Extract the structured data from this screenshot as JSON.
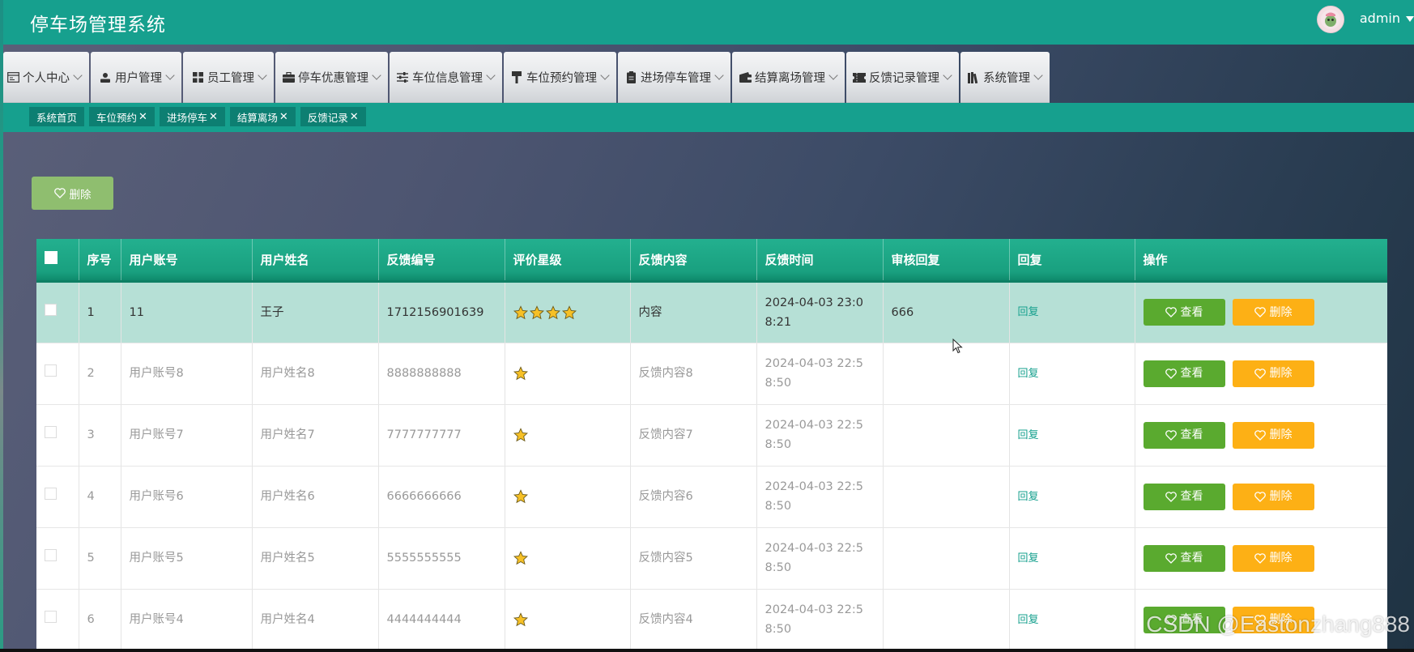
{
  "app": {
    "title": "停车场管理系统"
  },
  "user": {
    "name": "admin"
  },
  "menu": [
    {
      "label": "个人中心",
      "icon": "profile-card-icon"
    },
    {
      "label": "用户管理",
      "icon": "user-icon"
    },
    {
      "label": "员工管理",
      "icon": "grid-icon"
    },
    {
      "label": "停车优惠管理",
      "icon": "briefcase-icon"
    },
    {
      "label": "车位信息管理",
      "icon": "sliders-icon"
    },
    {
      "label": "车位预约管理",
      "icon": "pin-icon"
    },
    {
      "label": "进场停车管理",
      "icon": "clipboard-icon"
    },
    {
      "label": "结算离场管理",
      "icon": "wallet-icon"
    },
    {
      "label": "反馈记录管理",
      "icon": "ticket-icon"
    },
    {
      "label": "系统管理",
      "icon": "books-icon"
    }
  ],
  "tags": [
    {
      "label": "系统首页",
      "closable": false
    },
    {
      "label": "车位预约",
      "closable": true
    },
    {
      "label": "进场停车",
      "closable": true
    },
    {
      "label": "结算离场",
      "closable": true
    },
    {
      "label": "反馈记录",
      "closable": true
    }
  ],
  "toolbar": {
    "delete_label": "删除"
  },
  "table": {
    "headers": [
      "",
      "序号",
      "用户账号",
      "用户姓名",
      "反馈编号",
      "评价星级",
      "反馈内容",
      "反馈时间",
      "审核回复",
      "回复",
      "操作"
    ],
    "reply_label": "回复",
    "view_label": "查看",
    "delete_label": "删除",
    "rows": [
      {
        "index": "1",
        "account": "11",
        "name": "王子",
        "code": "1712156901639",
        "stars": 4,
        "content": "内容",
        "time": "2024-04-03 23:08:21",
        "review": "666",
        "selected": true
      },
      {
        "index": "2",
        "account": "用户账号8",
        "name": "用户姓名8",
        "code": "8888888888",
        "stars": 1,
        "content": "反馈内容8",
        "time": "2024-04-03 22:58:50",
        "review": "",
        "selected": false
      },
      {
        "index": "3",
        "account": "用户账号7",
        "name": "用户姓名7",
        "code": "7777777777",
        "stars": 1,
        "content": "反馈内容7",
        "time": "2024-04-03 22:58:50",
        "review": "",
        "selected": false
      },
      {
        "index": "4",
        "account": "用户账号6",
        "name": "用户姓名6",
        "code": "6666666666",
        "stars": 1,
        "content": "反馈内容6",
        "time": "2024-04-03 22:58:50",
        "review": "",
        "selected": false
      },
      {
        "index": "5",
        "account": "用户账号5",
        "name": "用户姓名5",
        "code": "5555555555",
        "stars": 1,
        "content": "反馈内容5",
        "time": "2024-04-03 22:58:50",
        "review": "",
        "selected": false
      },
      {
        "index": "6",
        "account": "用户账号4",
        "name": "用户姓名4",
        "code": "4444444444",
        "stars": 1,
        "content": "反馈内容4",
        "time": "2024-04-03 22:58:50",
        "review": "",
        "selected": false
      }
    ]
  },
  "watermark": "CSDN @Eastonzhang888",
  "colors": {
    "brand": "#16a08e",
    "view_button": "#5aaa2f",
    "delete_button": "#fdb015",
    "selected_row": "#b6e0d6",
    "star": "#f6c026"
  }
}
